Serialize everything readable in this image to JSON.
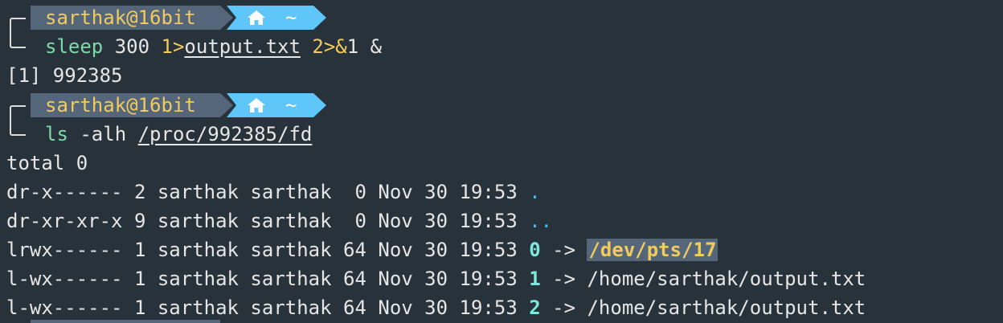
{
  "prompt": {
    "user_host": "sarthak@16bit",
    "dir": "~",
    "home_icon": "home-icon"
  },
  "cmd1": {
    "bin": "sleep",
    "arg": "300",
    "redir1": "1>",
    "file": "output.txt",
    "redir2": "2>&",
    "redir2_tail": "1",
    "bg": "&"
  },
  "job_line": "[1] 992385",
  "cmd2": {
    "bin": "ls",
    "flags": "-alh",
    "path": "/proc/992385/fd"
  },
  "total_line": "total 0",
  "listing": [
    {
      "meta": "dr-x------ 2 sarthak sarthak  0 Nov 30 19:53 ",
      "name": ".",
      "type": "dir"
    },
    {
      "meta": "dr-xr-xr-x 9 sarthak sarthak  0 Nov 30 19:53 ",
      "name": "..",
      "type": "dir"
    },
    {
      "meta": "lrwx------ 1 sarthak sarthak 64 Nov 30 19:53 ",
      "name": "0",
      "arrow": " -> ",
      "target": "/dev/pts/17",
      "type": "link-highlight"
    },
    {
      "meta": "l-wx------ 1 sarthak sarthak 64 Nov 30 19:53 ",
      "name": "1",
      "arrow": " -> ",
      "target": "/home/sarthak/output.txt",
      "type": "link"
    },
    {
      "meta": "l-wx------ 1 sarthak sarthak 64 Nov 30 19:53 ",
      "name": "2",
      "arrow": " -> ",
      "target": "/home/sarthak/output.txt",
      "type": "link"
    }
  ],
  "colors": {
    "background": "#28323b",
    "segment_user": "#55667a",
    "segment_dir": "#5ec6f8",
    "yellow": "#f2cb5d",
    "green": "#7fd9a8",
    "cyan": "#7de8dc",
    "blue": "#49b8f5"
  }
}
